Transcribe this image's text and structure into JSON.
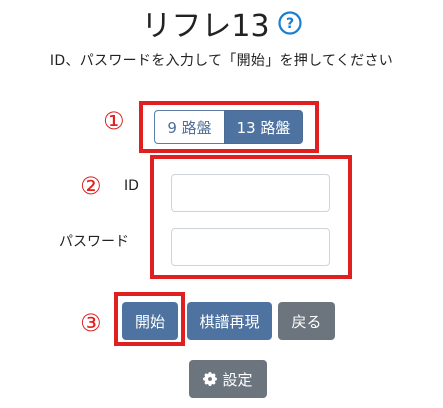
{
  "title": "リフレ13",
  "help_symbol": "?",
  "instruction": "ID、パスワードを入力して「開始」を押してください",
  "markers": [
    "①",
    "②",
    "③"
  ],
  "board_size": {
    "options": [
      "9 路盤",
      "13 路盤"
    ],
    "selected": "13 路盤"
  },
  "form": {
    "id_label": "ID",
    "id_value": "",
    "password_label": "パスワード",
    "password_value": ""
  },
  "buttons": {
    "start": "開始",
    "replay": "棋譜再現",
    "back": "戻る",
    "settings": "設定"
  },
  "colors": {
    "primary": "#4e73a0",
    "secondary": "#6c757d",
    "annotation_red": "#e02020",
    "help_blue": "#1a7fd1"
  },
  "icons": {
    "help": "question-circle-icon",
    "settings": "gear-icon"
  }
}
